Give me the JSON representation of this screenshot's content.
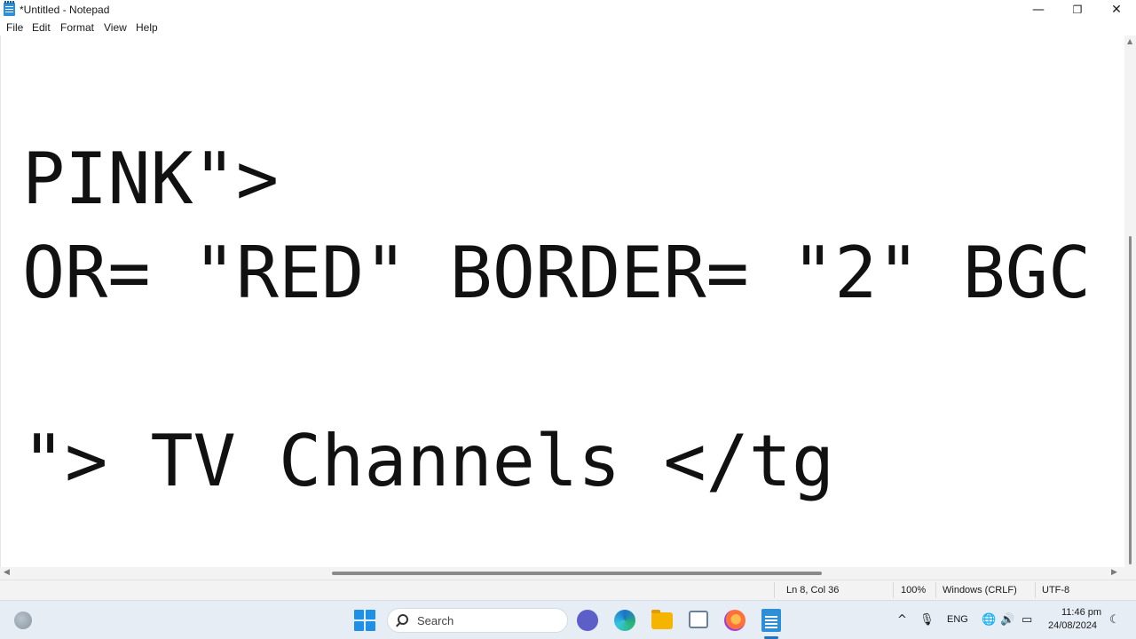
{
  "window": {
    "title": "*Untitled - Notepad",
    "icon": "notepad-icon",
    "controls": {
      "minimize": "—",
      "maximize": "❐",
      "close": "✕"
    }
  },
  "menu": {
    "items": [
      {
        "label": "File"
      },
      {
        "label": "Edit"
      },
      {
        "label": "Format"
      },
      {
        "label": "View"
      },
      {
        "label": "Help"
      }
    ]
  },
  "editor": {
    "lines": [
      "PINK\">",
      "OR= \"RED\" BORDER= \"2\" BGC",
      "\"> TV Channels </tg"
    ],
    "font_color": "#111111"
  },
  "scrollbars": {
    "horizontal": {
      "left_arrow": "◀",
      "right_arrow": "▶"
    },
    "vertical": {
      "up_arrow": "▲"
    }
  },
  "status": {
    "position": "Ln 8, Col 36",
    "zoom": "100%",
    "line_endings": "Windows (CRLF)",
    "encoding": "UTF-8"
  },
  "taskbar": {
    "search_label": "Search",
    "pinned_icons": [
      "windows-start-icon",
      "search-icon",
      "meet-icon",
      "edge-icon",
      "file-explorer-icon",
      "snipping-tool-icon",
      "firefox-icon",
      "notepad-icon"
    ],
    "tray": {
      "chevron": "^",
      "mic": "🎙",
      "language": "ENG",
      "network": "🌐",
      "volume": "🔊",
      "battery": "▭",
      "notification": "☾"
    },
    "clock": {
      "time": "11:46 pm",
      "date": "24/08/2024"
    },
    "accent_color": "#1a73c9"
  }
}
